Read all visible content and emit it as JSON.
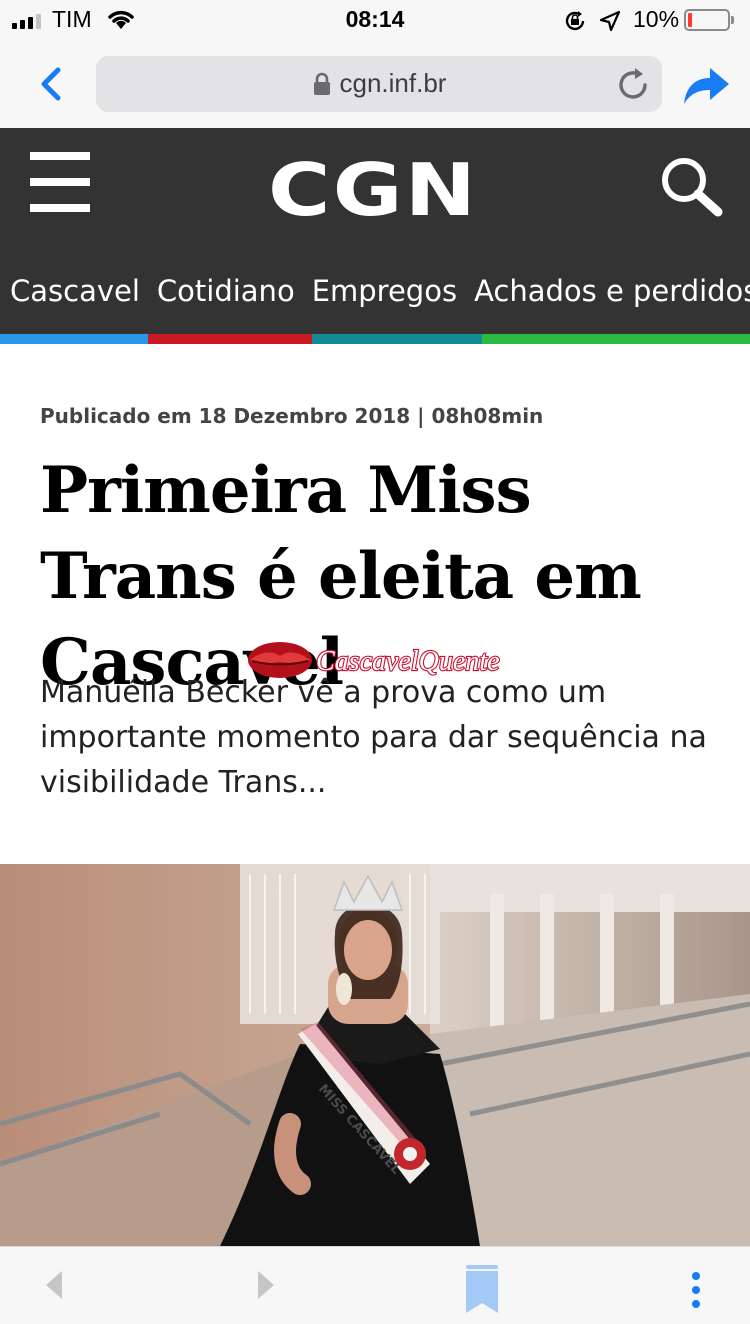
{
  "status_bar": {
    "carrier": "TIM",
    "time": "08:14",
    "battery_percent": "10%",
    "battery_level": 0.1,
    "icons": [
      "signal-icon",
      "wifi-icon",
      "orientation-lock-icon",
      "location-arrow-icon",
      "battery-icon"
    ]
  },
  "browser": {
    "url": "cgn.inf.br",
    "icons": [
      "back-chevron-icon",
      "lock-icon",
      "reload-icon",
      "share-icon"
    ]
  },
  "site": {
    "logo": "CGN",
    "nav": [
      "Cascavel",
      "Cotidiano",
      "Empregos",
      "Achados e perdidos"
    ],
    "strip_colors": [
      "#2a97e8",
      "#c91b25",
      "#138a96",
      "#2db941"
    ],
    "accent_dark": "#333333"
  },
  "article": {
    "published": "Publicado em 18 Dezembro 2018 | 08h08min",
    "headline": "Primeira Miss Trans é eleita em Cascavel",
    "subtitle": "Manuélla Becker vê a prova como um importante momento para dar sequência na visibilidade Trans...",
    "watermark": "CascavelQuente",
    "sash_text": "MISS CASCAVEL"
  },
  "toolbar": {
    "icons": [
      "back-arrow-icon",
      "forward-arrow-icon",
      "bookmark-icon",
      "more-icon"
    ],
    "accent": "#1a7cf5"
  }
}
